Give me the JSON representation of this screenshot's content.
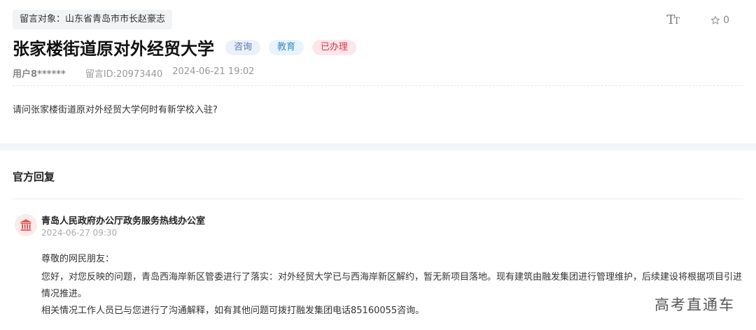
{
  "message": {
    "recipient": "留言对象：山东省青岛市市长赵豪志",
    "title": "张家楼街道原对外经贸大学",
    "tags": [
      {
        "label": "咨询"
      },
      {
        "label": "教育"
      },
      {
        "label": "已办理"
      }
    ],
    "user": "用户8******",
    "message_id": "留言ID:20973440",
    "datetime": "2024-06-21 19:02",
    "content": "请问张家楼街道原对外经贸大学何时有新学校入驻?"
  },
  "toolbar": {
    "font_size_big": "T",
    "font_size_small": "T",
    "favorite_count": "0"
  },
  "reply_section": {
    "heading": "官方回复",
    "office": "青岛人民政府办公厅政务服务热线办公室",
    "datetime": "2024-06-27 09:30",
    "greeting": "尊敬的网民朋友：",
    "paragraph1": "您好，对您反映的问题，青岛西海岸新区管委进行了落实：对外经贸大学已与西海岸新区解约，暂无新项目落地。现有建筑由融发集团进行管理维护，后续建设将根据项目引进情况推进。",
    "paragraph2": "相关情况工作人员已与您进行了沟通解释，如有其他问题可拨打融发集团电话85160055咨询。"
  },
  "watermark": "高考直通车",
  "colors": {
    "tag_consult_bg": "#eaf1fb",
    "tag_edu_bg": "#e7f4fb",
    "tag_done_bg": "#fde7ea",
    "tag_done_text": "#d9364a"
  }
}
